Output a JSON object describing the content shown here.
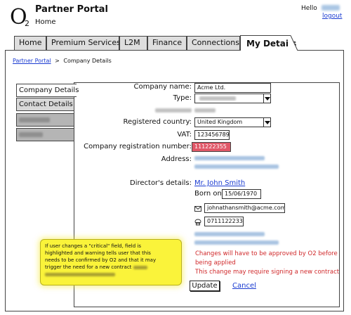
{
  "header": {
    "logo_letter": "O",
    "logo_sub": "2",
    "portal_title": "Partner Portal",
    "page_label": "Home",
    "greeting": "Hello",
    "logout_label": "logout"
  },
  "tabs": [
    {
      "label": "Home",
      "active": false
    },
    {
      "label": "Premium Services",
      "active": false
    },
    {
      "label": "L2M",
      "active": false
    },
    {
      "label": "Finance",
      "active": false
    },
    {
      "label": "Connections",
      "active": false
    },
    {
      "label": "My Details",
      "active": true
    }
  ],
  "breadcrumb": {
    "root": "Partner Portal",
    "separator": ">",
    "current": "Company Details"
  },
  "sidebar": {
    "items": [
      {
        "label": "Company Details",
        "active": true
      },
      {
        "label": "Contact Details",
        "active": false
      }
    ]
  },
  "form": {
    "company_name_label": "Company name:",
    "company_name_value": "Acme Ltd.",
    "type_label": "Type:",
    "registered_country_label": "Registered country:",
    "registered_country_value": "United Kingdom",
    "vat_label": "VAT:",
    "vat_value": "123456789",
    "company_reg_label": "Company registration number:",
    "company_reg_value": "111222355",
    "address_label": "Address:",
    "directors_label": "Director's details:",
    "director_name": "Mr. John Smith",
    "born_on_label": "Born on",
    "born_on_value": "15/06/1970",
    "email_value": "johnathansmith@acme.com",
    "phone_value": "0711122233"
  },
  "warnings": {
    "line1": "Changes will have to be approved by O2 before",
    "line2": "being applied",
    "line3": "This change may require signing a new contract"
  },
  "actions": {
    "update_label": "Update",
    "cancel_label": "Cancel"
  },
  "annotation": {
    "line1": "If user changes a \"critical\" field, field is",
    "line2": "highlighted and warning tells user that this",
    "line3": "needs to be confirmed by O2 and that it may",
    "line4": "trigger the need for a new contract"
  },
  "colors": {
    "highlight_field": "#e05868",
    "link": "#1a3bd1",
    "warning_text": "#d0282a",
    "sticky_note": "#faf33a"
  }
}
